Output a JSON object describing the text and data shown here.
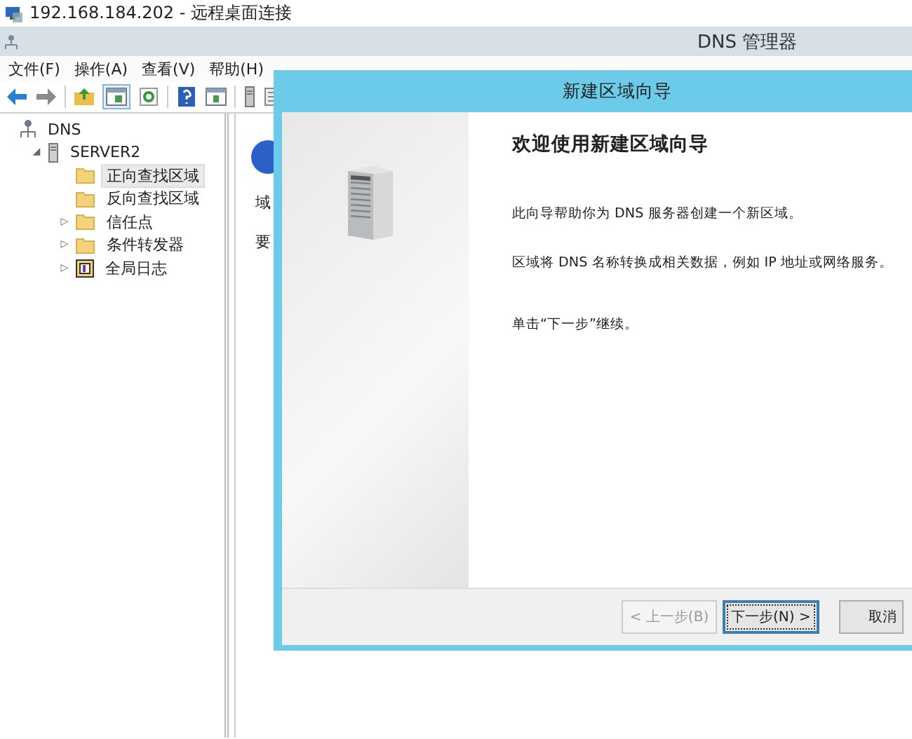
{
  "rdp_window": {
    "title": "192.168.184.202 - 远程桌面连接"
  },
  "window": {
    "title": "DNS 管理器"
  },
  "menu": [
    "文件(F)",
    "操作(A)",
    "查看(V)",
    "帮助(H)"
  ],
  "tree": [
    {
      "label": "DNS",
      "kind": "root",
      "selected": false,
      "children": [
        {
          "label": "SERVER2",
          "kind": "server",
          "expander": "◢",
          "selected": false,
          "children": [
            {
              "label": "正向查找区域",
              "kind": "folder",
              "selected": true
            },
            {
              "label": "反向查找区域",
              "kind": "folder",
              "selected": false
            },
            {
              "label": "信任点",
              "kind": "folder",
              "expander": "▷",
              "selected": false
            },
            {
              "label": "条件转发器",
              "kind": "folder",
              "expander": "▷",
              "selected": false
            },
            {
              "label": "全局日志",
              "kind": "log",
              "expander": "▷",
              "selected": false
            }
          ]
        }
      ]
    }
  ],
  "details": [
    "域",
    "要"
  ],
  "dialog": {
    "title": "新建区域向导",
    "heading": "欢迎使用新建区域向导",
    "paragraphs": [
      "此向导帮助你为 DNS 服务器创建一个新区域。",
      "区域将 DNS 名称转换成相关数据，例如 IP 地址或网络服务。",
      "单击“下一步”继续。"
    ],
    "buttons": [
      {
        "label": "< 上一步(B)",
        "disabled": true,
        "default": false
      },
      {
        "label": "下一步(N) >",
        "disabled": false,
        "default": true
      },
      {
        "label": "取消",
        "disabled": false,
        "default": false
      }
    ]
  }
}
